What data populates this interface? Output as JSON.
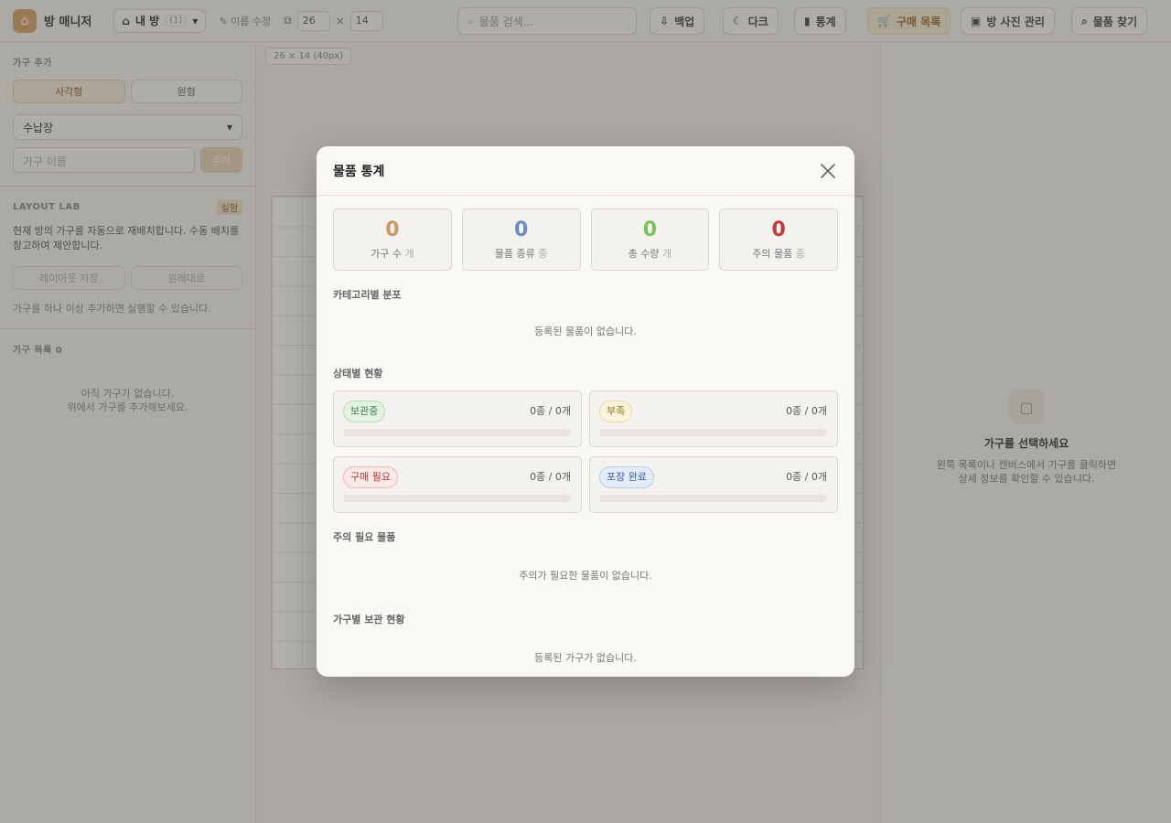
{
  "topbar": {
    "app_name": "방 매니저",
    "room_select": {
      "label": "내 방",
      "count": "(1)"
    },
    "rename_label": "이름 수정",
    "size": {
      "width": "26",
      "times": "×",
      "height": "14"
    },
    "search": {
      "placeholder": "물품 검색..."
    },
    "buttons": {
      "export": "백업",
      "theme": "다크",
      "stats": "통계",
      "shopping": "구매 목록",
      "all_photos": "방 사진 관리",
      "item_search": "물품 찾기"
    }
  },
  "sidebar": {
    "furniture_add_title": "가구 추가",
    "segments": [
      "사각형",
      "원형"
    ],
    "type_value": "수납장",
    "name_placeholder": "가구 이름",
    "add_button": "추가",
    "lab_title": "LAYOUT LAB",
    "lab_badge": "실험",
    "lab_desc": "현재 방의 가구를 자동으로 재배치합니다. 수동 배치를 참고하여 제안합니다.",
    "lab_buttons": [
      "레이아웃 저장",
      "원래대로"
    ],
    "lab_note": "가구를 하나 이상 추가하면 실행할 수 있습니다.",
    "list_title": "가구 목록 0",
    "list_empty": [
      "아직 가구가 없습니다.",
      "위에서 가구를 추가해보세요."
    ]
  },
  "canvas": {
    "dim_tag": "26 × 14 (40px)"
  },
  "detail": {
    "title": "가구를 선택하세요",
    "desc": "왼쪽 목록이나 캔버스에서 가구를 클릭하면 상세 정보를 확인할 수 있습니다."
  },
  "modal": {
    "title": "물품 통계",
    "stats": [
      {
        "value": "0",
        "label": "가구 수",
        "unit": "개",
        "color": "#c89a6a"
      },
      {
        "value": "0",
        "label": "물품 종류",
        "unit": "종",
        "color": "#6b8cc2"
      },
      {
        "value": "0",
        "label": "총 수량",
        "unit": "개",
        "color": "#7cbf5f"
      },
      {
        "value": "0",
        "label": "주의 물품",
        "unit": "종",
        "color": "#c0393b"
      }
    ],
    "category_title": "카테고리별 분포",
    "category_empty": "등록된 물품이 없습니다.",
    "status_title": "상태별 현황",
    "statuses": [
      {
        "label": "보관중",
        "count": "0종 / 0개",
        "fill": 0,
        "text_color": "#3a7d44",
        "bg": "#e3f2e1",
        "border": "#b9dcb6"
      },
      {
        "label": "부족",
        "count": "0종 / 0개",
        "fill": 0,
        "text_color": "#8a6d1f",
        "bg": "#fbf4dc",
        "border": "#ecd9a0"
      },
      {
        "label": "구매 필요",
        "count": "0종 / 0개",
        "fill": 0,
        "text_color": "#b23a3a",
        "bg": "#fbe9e7",
        "border": "#f0b9b4"
      },
      {
        "label": "포장 완료",
        "count": "0종 / 0개",
        "fill": 0,
        "text_color": "#3a5f9c",
        "bg": "#e4ecf9",
        "border": "#b8cbee"
      }
    ],
    "attention_title": "주의 필요 물품",
    "attention_empty": "주의가 필요한 물품이 없습니다.",
    "furniture_title": "가구별 보관 현황",
    "furniture_empty": "등록된 가구가 없습니다."
  }
}
